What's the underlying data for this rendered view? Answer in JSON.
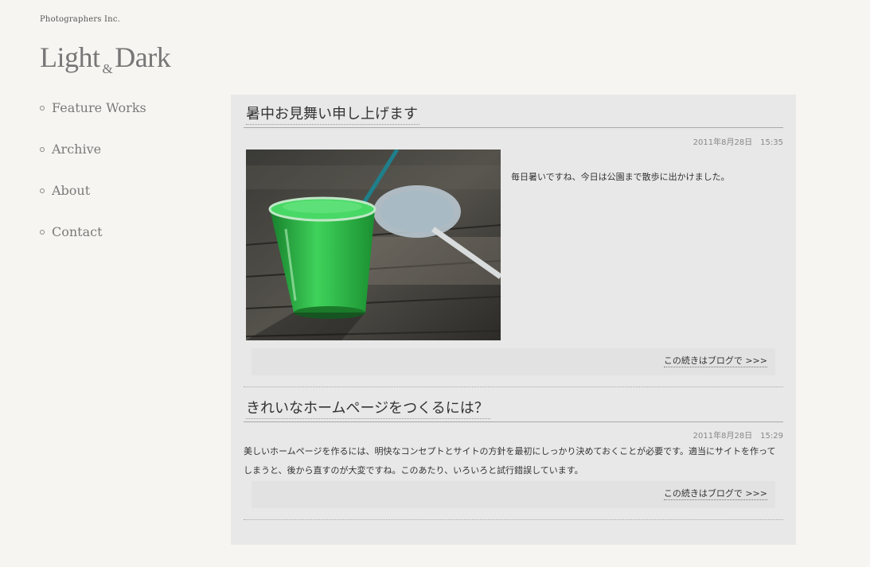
{
  "site": {
    "company": "Photographers Inc.",
    "logo_part1": "Light",
    "logo_amp": "&",
    "logo_part2": "Dark"
  },
  "nav": {
    "items": [
      {
        "label": "Feature Works"
      },
      {
        "label": "Archive"
      },
      {
        "label": "About"
      },
      {
        "label": "Contact"
      }
    ]
  },
  "posts": [
    {
      "title": "暑中お見舞い申し上げます",
      "date": "2011年8月28日　15:35",
      "body": "毎日暑いですね、今日は公園まで散歩に出かけました。",
      "more": "この続きはブログで >>>",
      "photo_icon": "green-soda-photo"
    },
    {
      "title": "きれいなホームページをつくるには？",
      "date": "2011年8月28日　15:29",
      "body": "美しいホームページを作るには、明快なコンセプトとサイトの方針を最初にしっかり決めておくことが必要です。適当にサイトを作ってしまうと、後から直すのが大変ですね。このあたり、いろいろと試行錯誤しています。",
      "more": "この続きはブログで >>>"
    }
  ],
  "colors": {
    "page_bg": "#f7f5f2",
    "content_bg": "#e8e8e8",
    "soda_green": "#2fc24a"
  }
}
